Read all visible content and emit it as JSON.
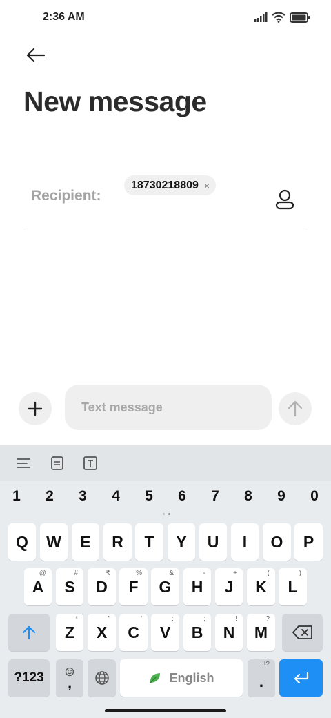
{
  "status_bar": {
    "time": "2:36 AM"
  },
  "header": {
    "title": "New message"
  },
  "recipient": {
    "label": "Recipient:",
    "chips": [
      {
        "number": "18730218809",
        "remove_symbol": "×"
      }
    ]
  },
  "composer": {
    "placeholder": "Text message"
  },
  "keyboard": {
    "numbers": [
      "1",
      "2",
      "3",
      "4",
      "5",
      "6",
      "7",
      "8",
      "9",
      "0"
    ],
    "row1": [
      "Q",
      "W",
      "E",
      "R",
      "T",
      "Y",
      "U",
      "I",
      "O",
      "P"
    ],
    "row2": [
      "A",
      "S",
      "D",
      "F",
      "G",
      "H",
      "J",
      "K",
      "L"
    ],
    "row2_hints": [
      "@",
      "#",
      "₹",
      "%",
      "&",
      "-",
      "+",
      "(",
      ")"
    ],
    "row3": [
      "Z",
      "X",
      "C",
      "V",
      "B",
      "N",
      "M"
    ],
    "row3_hints": [
      "*",
      "\"",
      "'",
      ":",
      ";",
      "!",
      "?"
    ],
    "num_toggle_label": "?123",
    "comma": ",",
    "space_label": "English",
    "period": ".",
    "period_hint": ",!?"
  },
  "colors": {
    "accent": "#1e90f5",
    "keyboard_bg": "#e9ecef",
    "toolbar_bg": "#e2e5e8"
  },
  "icons": [
    "back-arrow-icon",
    "contact-icon",
    "plus-icon",
    "send-arrow-icon",
    "wifi-icon",
    "signal-icon",
    "battery-icon",
    "shift-icon",
    "backspace-icon",
    "globe-icon",
    "emoji-icon",
    "leaf-icon",
    "enter-icon"
  ]
}
